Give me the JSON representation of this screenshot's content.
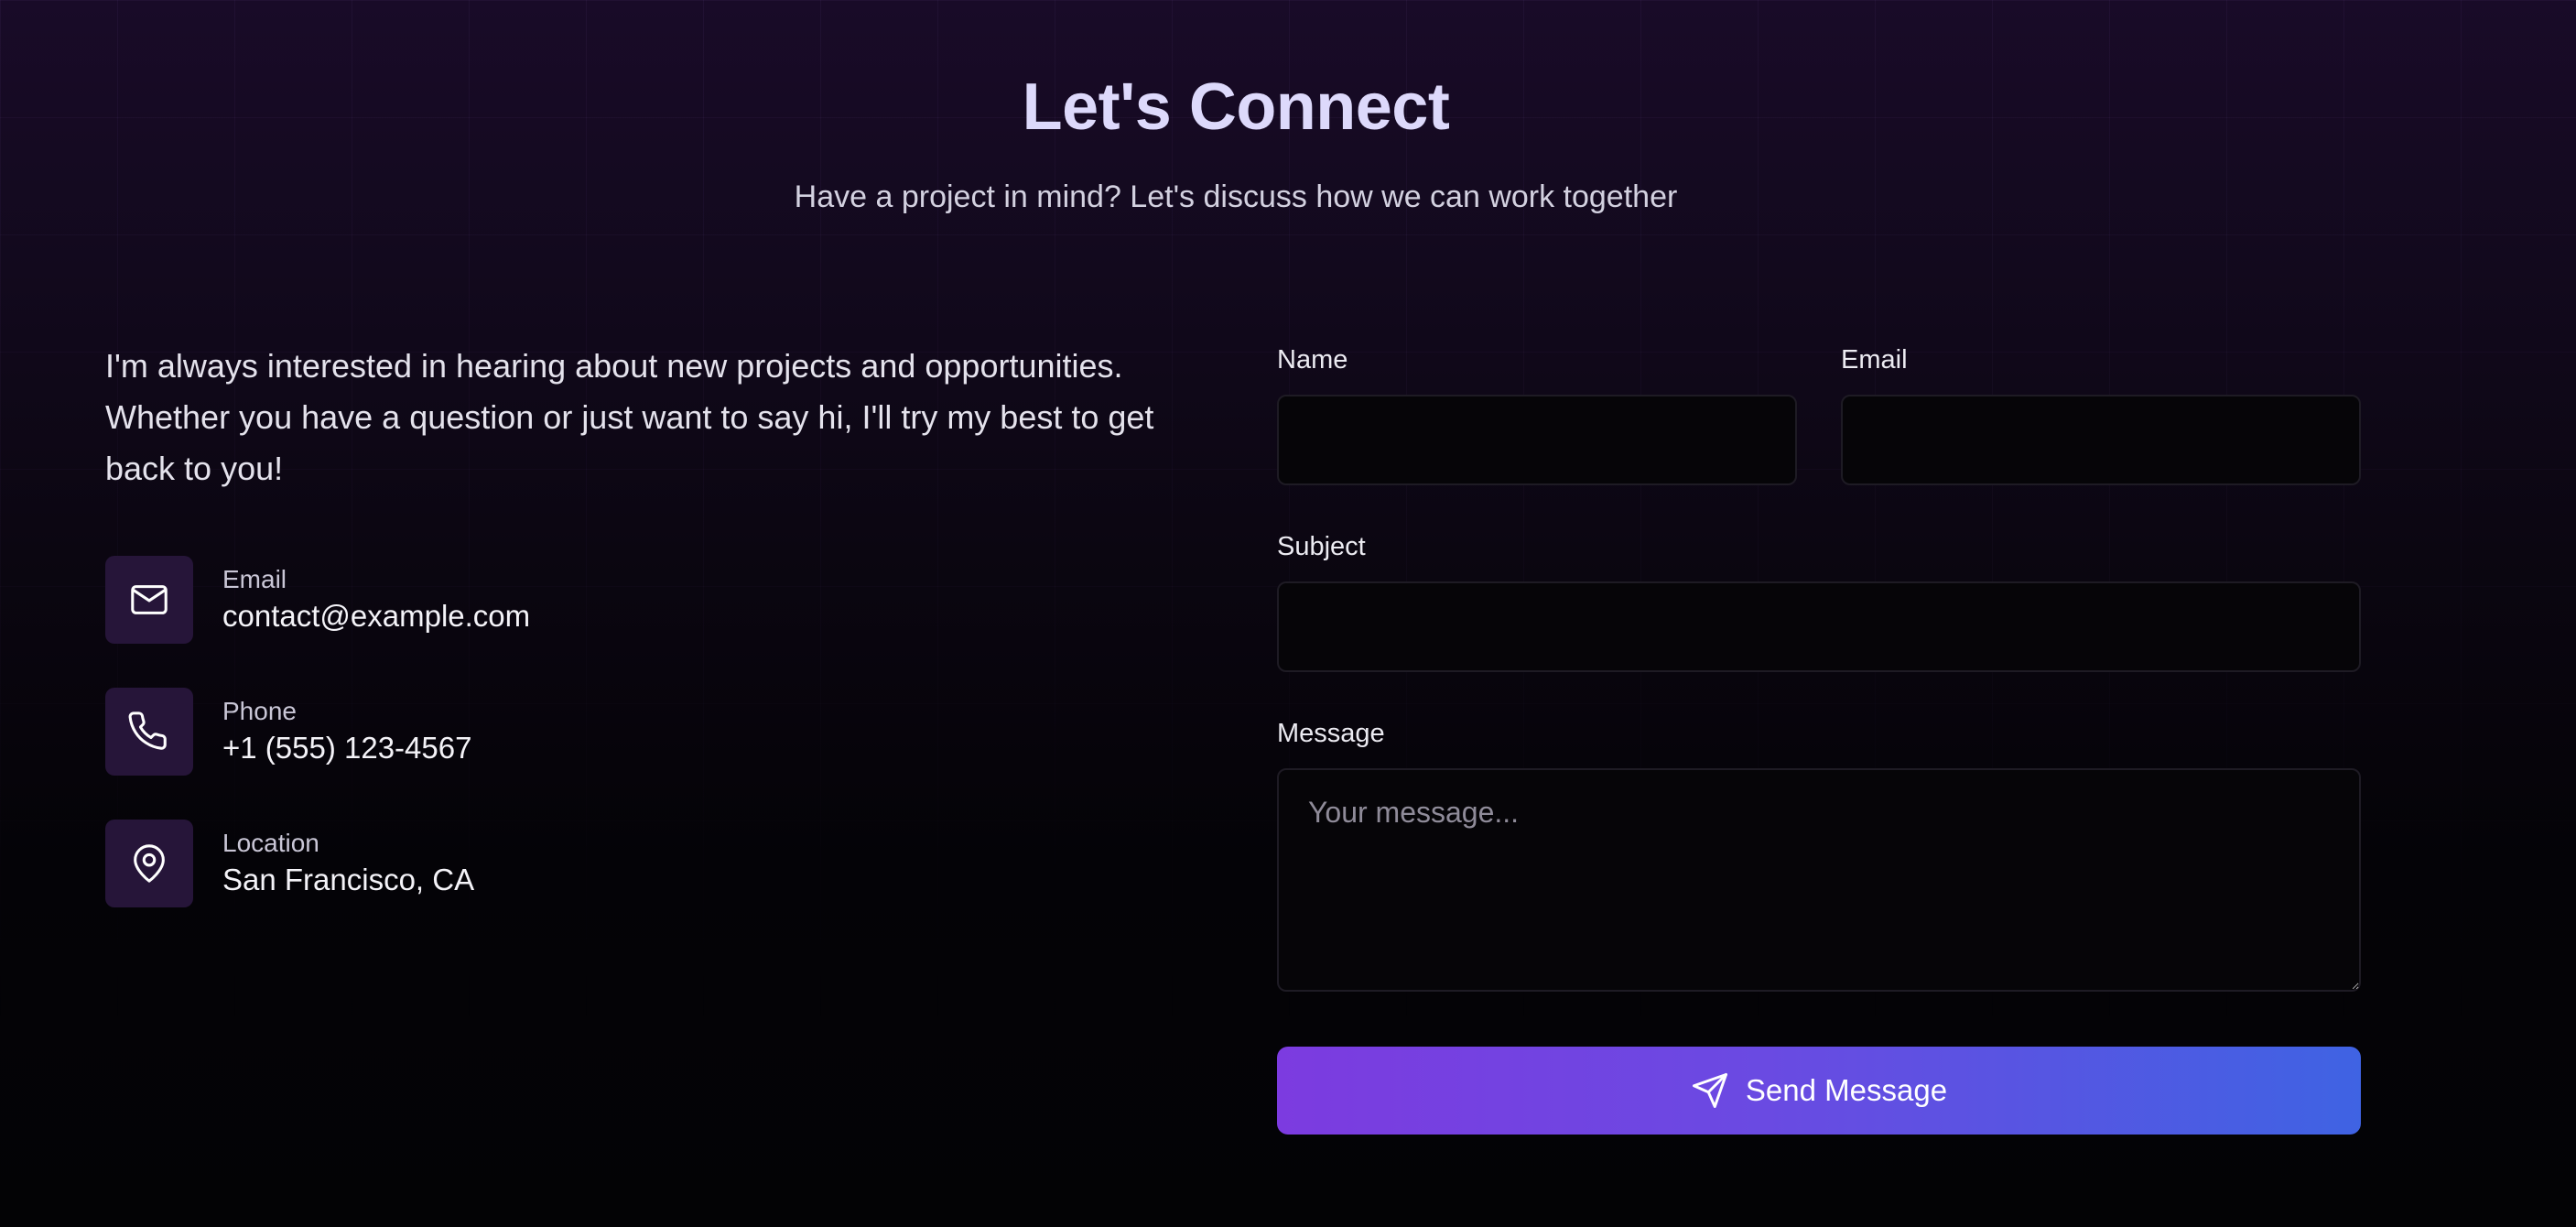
{
  "header": {
    "title": "Let's Connect",
    "subtitle": "Have a project in mind? Let's discuss how we can work together"
  },
  "intro": "I'm always interested in hearing about new projects and opportunities. Whether you have a question or just want to say hi, I'll try my best to get back to you!",
  "contact": {
    "items": [
      {
        "label": "Email",
        "value": "contact@example.com",
        "icon": "mail-icon"
      },
      {
        "label": "Phone",
        "value": "+1 (555) 123-4567",
        "icon": "phone-icon"
      },
      {
        "label": "Location",
        "value": "San Francisco, CA",
        "icon": "map-pin-icon"
      }
    ]
  },
  "form": {
    "name_label": "Name",
    "name_value": "",
    "email_label": "Email",
    "email_value": "",
    "subject_label": "Subject",
    "subject_value": "",
    "message_label": "Message",
    "message_placeholder": "Your message...",
    "submit_label": "Send Message"
  },
  "colors": {
    "accent_start": "#7c3be0",
    "accent_end": "#3f63e3",
    "title": "#ddd9fb",
    "icon_tile": "#261539"
  }
}
